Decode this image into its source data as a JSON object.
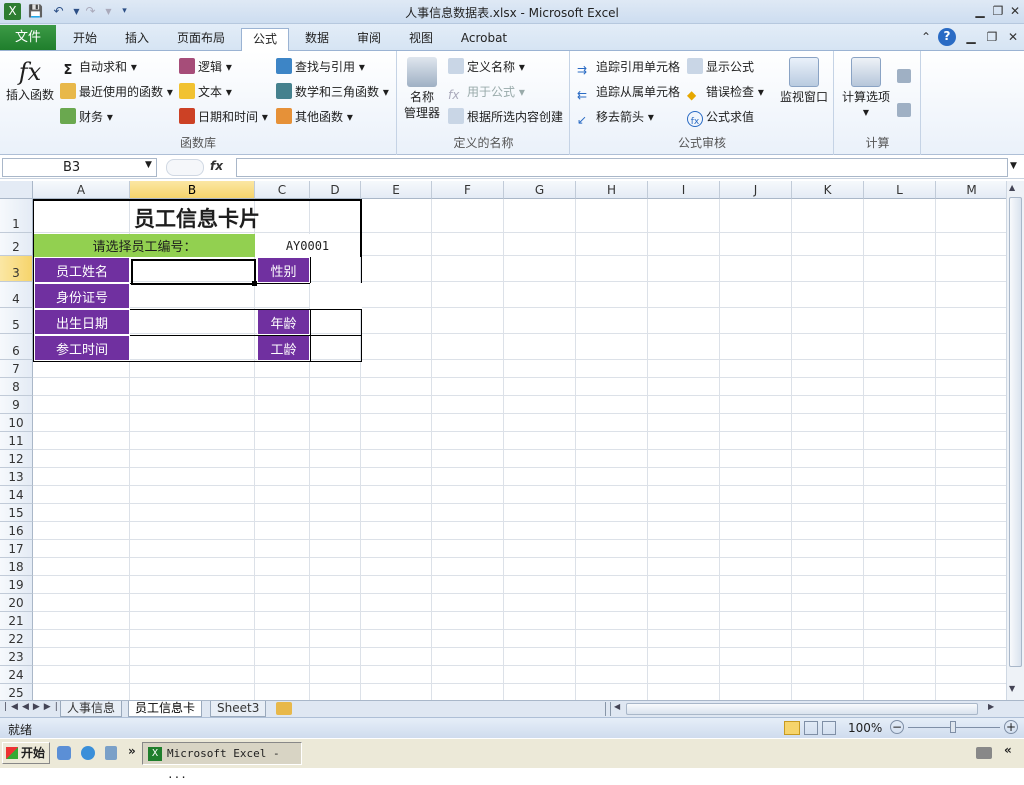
{
  "window": {
    "title": "人事信息数据表.xlsx - Microsoft Excel"
  },
  "tabs": [
    "文件",
    "开始",
    "插入",
    "页面布局",
    "公式",
    "数据",
    "审阅",
    "视图",
    "Acrobat"
  ],
  "active_tab": "公式",
  "ribbon": {
    "insert_func": "插入函数",
    "autosum": "自动求和",
    "recent": "最近使用的函数",
    "finance": "财务",
    "logic": "逻辑",
    "text": "文本",
    "datetime": "日期和时间",
    "lookup": "查找与引用",
    "math": "数学和三角函数",
    "other": "其他函数",
    "group_funclib": "函数库",
    "name_mgr_1": "名称",
    "name_mgr_2": "管理器",
    "define_name": "定义名称",
    "use_in_formula": "用于公式",
    "create_from_sel": "根据所选内容创建",
    "group_names": "定义的名称",
    "trace_prec": "追踪引用单元格",
    "trace_dep": "追踪从属单元格",
    "remove_arrows": "移去箭头",
    "show_formulas": "显示公式",
    "error_check": "错误检查",
    "eval_formula": "公式求值",
    "watch_window": "监视窗口",
    "group_audit": "公式审核",
    "calc_options": "计算选项",
    "group_calc": "计算"
  },
  "formula_bar": {
    "name_box": "B3",
    "fx": "fx",
    "formula": ""
  },
  "columns": [
    "A",
    "B",
    "C",
    "D",
    "E",
    "F",
    "G",
    "H",
    "I",
    "J",
    "K",
    "L",
    "M"
  ],
  "rows": [
    "1",
    "2",
    "3",
    "4",
    "5",
    "6",
    "7",
    "8",
    "9",
    "10",
    "11",
    "12",
    "13",
    "14",
    "15",
    "16",
    "17",
    "18",
    "19",
    "20",
    "21",
    "22",
    "23",
    "24",
    "25"
  ],
  "card": {
    "title": "员工信息卡片",
    "select_label": "请选择员工编号：",
    "employee_id": "AY0001",
    "name_label": "员工姓名",
    "gender_label": "性别",
    "id_label": "身份证号",
    "birth_label": "出生日期",
    "age_label": "年龄",
    "join_label": "参工时间",
    "seniority_label": "工龄"
  },
  "sheet_tabs": [
    "人事信息",
    "员工信息卡",
    "Sheet3"
  ],
  "active_sheet": "员工信息卡",
  "status": {
    "ready": "就绪",
    "zoom": "100%"
  },
  "taskbar": {
    "start": "开始",
    "task": "Microsoft Excel - ..."
  }
}
